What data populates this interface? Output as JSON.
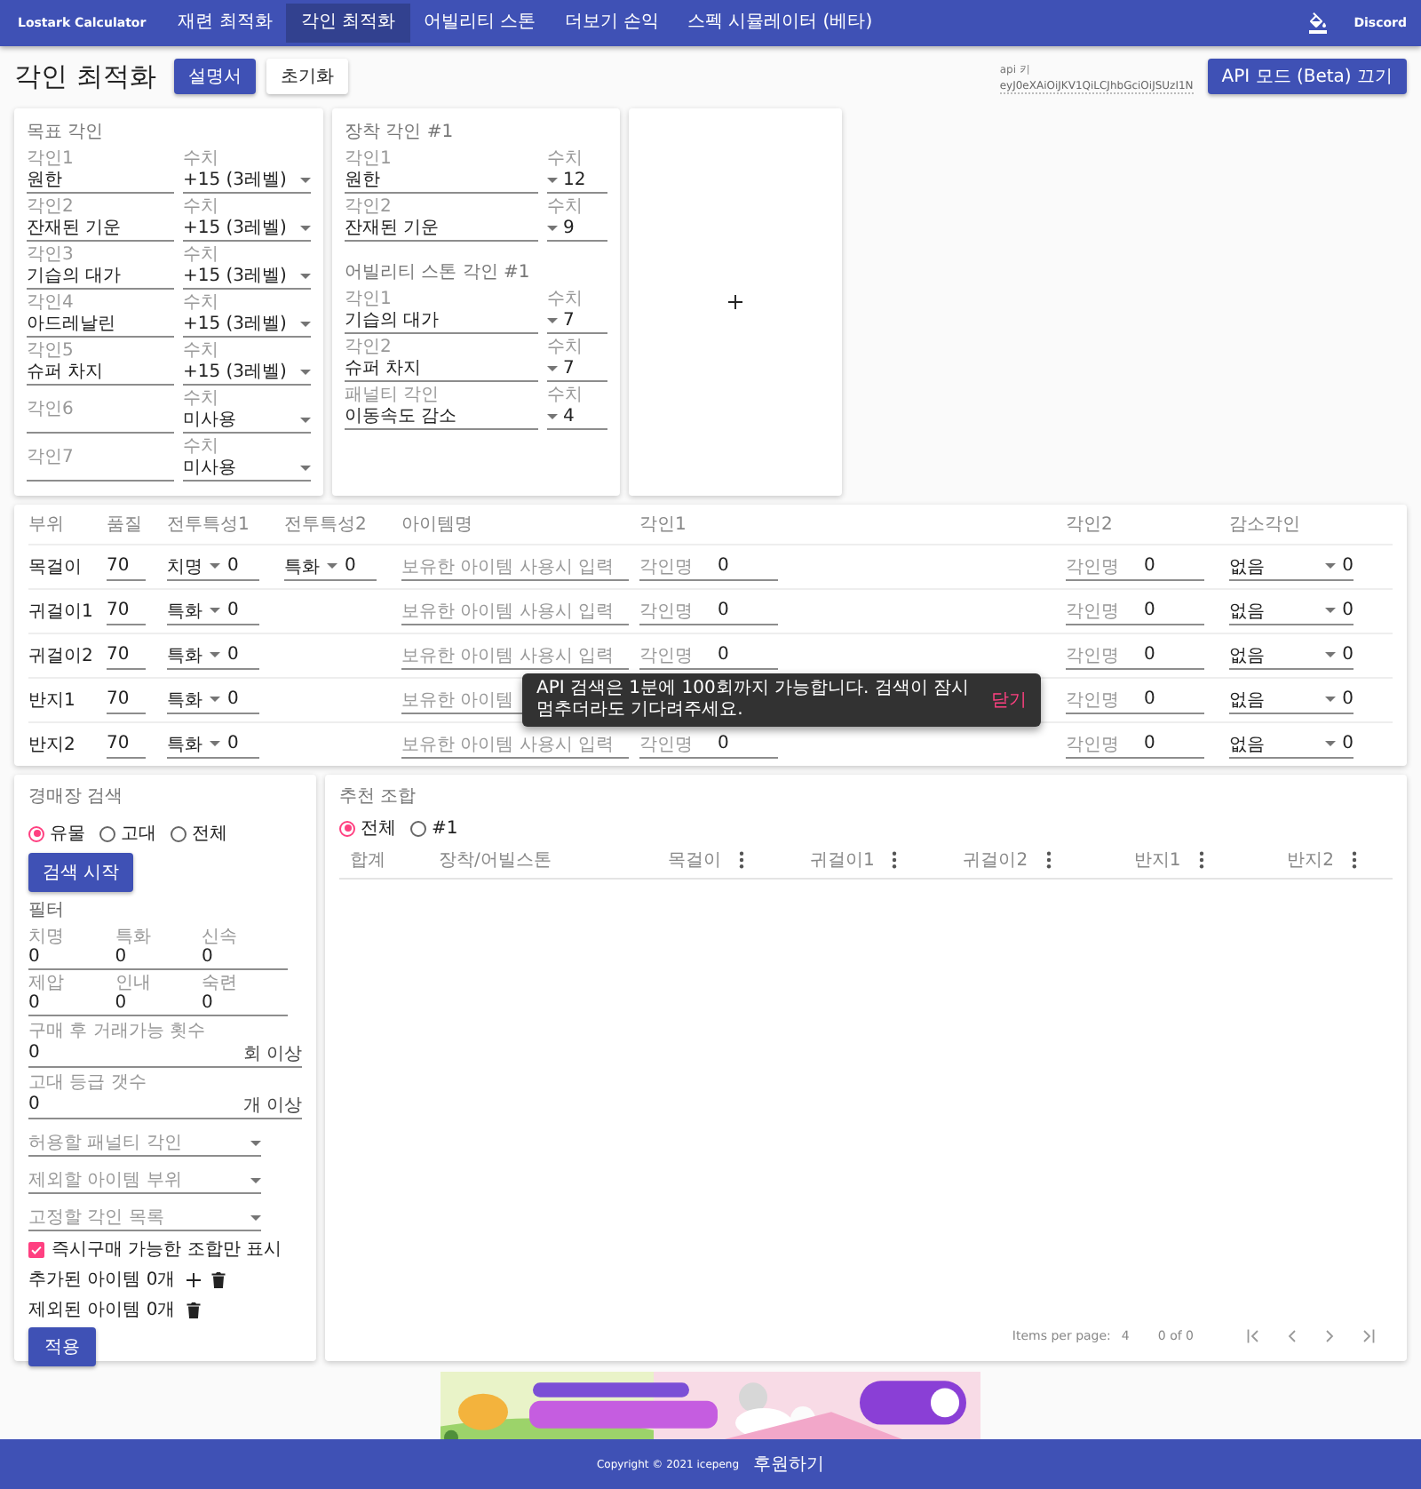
{
  "nav": {
    "brand": "Lostark Calculator",
    "tabs": [
      {
        "label": "재련 최적화",
        "selected": false
      },
      {
        "label": "각인 최적화",
        "selected": true
      },
      {
        "label": "어빌리티 스톤",
        "selected": false
      },
      {
        "label": "더보기 손익",
        "selected": false
      },
      {
        "label": "스펙 시뮬레이터 (베타)",
        "selected": false
      }
    ],
    "discord": "Discord"
  },
  "page": {
    "title": "각인 최적화",
    "buttons": [
      {
        "label": "설명서",
        "kind": "primary"
      },
      {
        "label": "초기화",
        "kind": "plain"
      }
    ]
  },
  "api_key": {
    "label": "api 키",
    "value": "eyJ0eXAiOiJKV1QiLCJhbGciOiJSUzI1N",
    "button": "API 모드 (Beta) 끄기"
  },
  "target_card": {
    "title": "목표 각인",
    "rows": [
      {
        "label": "각인1",
        "value": "원한",
        "level_label": "수치",
        "level_value": "+15 (3레벨)"
      },
      {
        "label": "각인2",
        "value": "잔재된 기운",
        "level_label": "수치",
        "level_value": "+15 (3레벨)"
      },
      {
        "label": "각인3",
        "value": "기습의 대가",
        "level_label": "수치",
        "level_value": "+15 (3레벨)"
      },
      {
        "label": "각인4",
        "value": "아드레날린",
        "level_label": "수치",
        "level_value": "+15 (3레벨)"
      },
      {
        "label": "각인5",
        "value": "슈퍼 차지",
        "level_label": "수치",
        "level_value": "+15 (3레벨)"
      },
      {
        "placeholder": "각인6",
        "level_label": "수치",
        "level_value": "미사용"
      },
      {
        "placeholder": "각인7",
        "level_label": "수치",
        "level_value": "미사용"
      }
    ]
  },
  "equip_card": {
    "sections": [
      {
        "title": "장착 각인 #1",
        "rows": [
          {
            "label": "각인1",
            "value": "원한",
            "level_label": "수치",
            "level_value": "12"
          },
          {
            "label": "각인2",
            "value": "잔재된 기운",
            "level_label": "수치",
            "level_value": "9"
          }
        ]
      },
      {
        "title": "어빌리티 스톤 각인 #1",
        "rows": [
          {
            "label": "각인1",
            "value": "기습의 대가",
            "level_label": "수치",
            "level_value": "7"
          },
          {
            "label": "각인2",
            "value": "슈퍼 차지",
            "level_label": "수치",
            "level_value": "7"
          },
          {
            "label": "패널티 각인",
            "value": "이동속도 감소",
            "level_label": "수치",
            "level_value": "4"
          }
        ]
      }
    ]
  },
  "equipment_table": {
    "columns": [
      "부위",
      "품질",
      "전투특성1",
      "전투특성2",
      "아이템명",
      "각인1",
      "각인2",
      "감소각인"
    ],
    "rows": [
      {
        "part": "목걸이",
        "quality": "70",
        "stat1": {
          "name": "치명",
          "value": "0"
        },
        "stat2": {
          "name": "특화",
          "value": "0"
        },
        "item_placeholder": "보유한 아이템 사용시 입력",
        "engraving1": {
          "placeholder": "각인명",
          "value": "0"
        },
        "engraving2": {
          "placeholder": "각인명",
          "value": "0"
        },
        "penalty": {
          "name": "없음",
          "value": "0"
        }
      },
      {
        "part": "귀걸이1",
        "quality": "70",
        "stat1": {
          "name": "특화",
          "value": "0"
        },
        "item_placeholder": "보유한 아이템 사용시 입력",
        "engraving1": {
          "placeholder": "각인명",
          "value": "0"
        },
        "engraving2": {
          "placeholder": "각인명",
          "value": "0"
        },
        "penalty": {
          "name": "없음",
          "value": "0"
        }
      },
      {
        "part": "귀걸이2",
        "quality": "70",
        "stat1": {
          "name": "특화",
          "value": "0"
        },
        "item_placeholder": "보유한 아이템 사용시 입력",
        "engraving1": {
          "placeholder": "각인명",
          "value": "0"
        },
        "engraving2": {
          "placeholder": "각인명",
          "value": "0"
        },
        "penalty": {
          "name": "없음",
          "value": "0"
        }
      },
      {
        "part": "반지1",
        "quality": "70",
        "stat1": {
          "name": "특화",
          "value": "0"
        },
        "item_placeholder": "보유한 아이템",
        "engraving2": {
          "placeholder": "각인명",
          "value": "0"
        },
        "penalty": {
          "name": "없음",
          "value": "0"
        }
      },
      {
        "part": "반지2",
        "quality": "70",
        "stat1": {
          "name": "특화",
          "value": "0"
        },
        "item_placeholder": "보유한 아이템 사용시 입력",
        "engraving1": {
          "placeholder": "각인명",
          "value": "0"
        },
        "engraving2": {
          "placeholder": "각인명",
          "value": "0"
        },
        "penalty": {
          "name": "없음",
          "value": "0"
        }
      }
    ]
  },
  "toast": {
    "message": "API 검색은 1분에 100회까지 가능합니다. 검색이 잠시 멈추더라도 기다려주세요.",
    "action": "닫기"
  },
  "auction_search": {
    "title": "경매장 검색",
    "tiers": [
      {
        "label": "유물",
        "selected": true
      },
      {
        "label": "고대",
        "selected": false
      },
      {
        "label": "전체",
        "selected": false
      }
    ],
    "search_button": "검색 시작",
    "filter_title": "필터",
    "stats": [
      {
        "label": "치명",
        "value": "0"
      },
      {
        "label": "특화",
        "value": "0"
      },
      {
        "label": "신속",
        "value": "0"
      },
      {
        "label": "제압",
        "value": "0"
      },
      {
        "label": "인내",
        "value": "0"
      },
      {
        "label": "숙련",
        "value": "0"
      }
    ],
    "min_fields": [
      {
        "label": "구매 후 거래가능 횟수",
        "value": "0",
        "suffix": "회 이상"
      },
      {
        "label": "고대 등급 갯수",
        "value": "0",
        "suffix": "개 이상"
      }
    ],
    "selects": [
      {
        "placeholder": "허용할 패널티 각인"
      },
      {
        "placeholder": "제외할 아이템 부위"
      },
      {
        "placeholder": "고정할 각인 목록"
      }
    ],
    "instant_buy": {
      "label": "즉시구매 가능한 조합만 표시",
      "checked": true
    },
    "added_items": "추가된 아이템 0개",
    "excluded_items": "제외된 아이템 0개",
    "apply_button": "적용"
  },
  "recommendations": {
    "title": "추천 조합",
    "filters": [
      {
        "label": "전체",
        "selected": true
      },
      {
        "label": "#1",
        "selected": false
      }
    ],
    "columns": [
      {
        "label": "합계",
        "kind": "plain"
      },
      {
        "label": "장착/어빌스톤",
        "kind": "plain"
      },
      {
        "label": "목걸이",
        "kind": "menu"
      },
      {
        "label": "귀걸이1",
        "kind": "menu"
      },
      {
        "label": "귀걸이2",
        "kind": "menu"
      },
      {
        "label": "반지1",
        "kind": "menu"
      },
      {
        "label": "반지2",
        "kind": "menu"
      }
    ],
    "pagination": {
      "label": "Items per page:",
      "per_page": "4",
      "range": "0 of 0"
    }
  },
  "footer": {
    "copyright": "Copyright © 2021 icepeng",
    "donate": "후원하기"
  }
}
